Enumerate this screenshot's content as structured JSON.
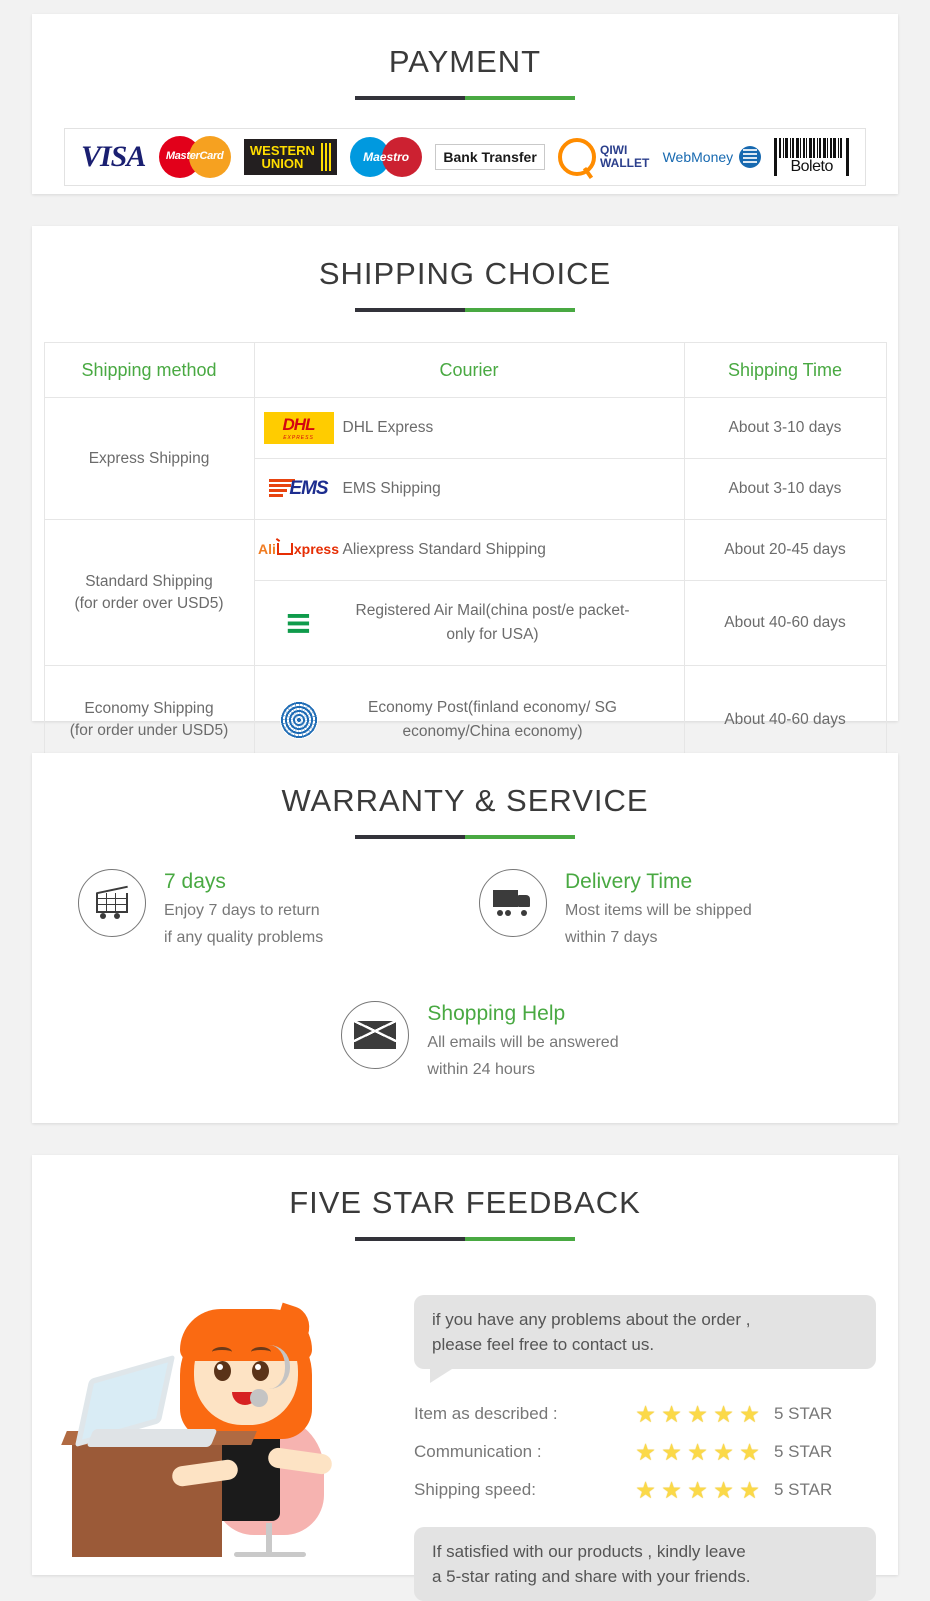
{
  "sections": {
    "payment": {
      "title": "PAYMENT",
      "methods": [
        {
          "name": "visa-logo",
          "label": "VISA"
        },
        {
          "name": "mastercard-logo",
          "label": "MasterCard"
        },
        {
          "name": "western-union-logo",
          "label_line1": "WESTERN",
          "label_line2": "UNION"
        },
        {
          "name": "maestro-logo",
          "label": "Maestro"
        },
        {
          "name": "bank-transfer-logo",
          "label": "Bank Transfer"
        },
        {
          "name": "qiwi-wallet-logo",
          "label_line1": "QIWI",
          "label_line2": "WALLET"
        },
        {
          "name": "webmoney-logo",
          "label": "WebMoney"
        },
        {
          "name": "boleto-logo",
          "label": "Boleto"
        }
      ]
    },
    "shipping": {
      "title": "SHIPPING CHOICE",
      "columns": [
        "Shipping method",
        "Courier",
        "Shipping Time"
      ],
      "groups": [
        {
          "method": "Express Shipping",
          "rows": [
            {
              "logo": "dhl-logo",
              "courier": "DHL Express",
              "time": "About 3-10 days"
            },
            {
              "logo": "ems-logo",
              "courier": "EMS Shipping",
              "time": "About 3-10 days"
            }
          ]
        },
        {
          "method": "Standard Shipping\n(for order over USD5)",
          "method_line1": "Standard Shipping",
          "method_line2": "(for order over USD5)",
          "rows": [
            {
              "logo": "aliexpress-logo",
              "courier": "Aliexpress Standard Shipping",
              "time": "About 20-45 days"
            },
            {
              "logo": "china-post-logo",
              "courier": "Registered Air Mail(china post/e packet-only for USA)",
              "time": "About 40-60 days"
            }
          ]
        },
        {
          "method_line1": "Economy Shipping",
          "method_line2": "(for order under USD5)",
          "rows": [
            {
              "logo": "un-post-logo",
              "courier": "Economy Post(finland economy/ SG economy/China economy)",
              "time": "About 40-60 days"
            }
          ]
        }
      ],
      "logo_text": {
        "dhl": "DHL",
        "dhl_sub": "EXPRESS",
        "ems": "EMS",
        "ali_a": "Ali",
        "ali_x": "xpress",
        "china_post": "≡"
      }
    },
    "warranty": {
      "title": "WARRANTY & SERVICE",
      "items": [
        {
          "icon": "cart-icon",
          "heading": "7 days",
          "line1": "Enjoy 7 days to return",
          "line2": "if any quality problems"
        },
        {
          "icon": "truck-icon",
          "heading": "Delivery Time",
          "line1": "Most items will be shipped",
          "line2": "within 7 days"
        },
        {
          "icon": "envelope-icon",
          "heading": "Shopping Help",
          "line1": "All emails will be answered",
          "line2": "within 24 hours"
        }
      ]
    },
    "feedback": {
      "title": "FIVE STAR FEEDBACK",
      "bubble_top_line1": "if you have any problems about the order ,",
      "bubble_top_line2": "please feel free to contact us.",
      "ratings": [
        {
          "label": "Item as described :",
          "stars": 5,
          "value": "5 STAR"
        },
        {
          "label": "Communication :",
          "stars": 5,
          "value": "5 STAR"
        },
        {
          "label": "Shipping speed:",
          "stars": 5,
          "value": "5 STAR"
        }
      ],
      "bubble_bottom_line1": "If satisfied with our products , kindly leave",
      "bubble_bottom_line2": "a 5-star rating and share with your friends.",
      "star_glyph": "★",
      "illustration": "customer-service-agent-illustration"
    }
  },
  "colors": {
    "green": "#49a942",
    "dark": "#33333a",
    "text_gray": "#6b6b6b",
    "page_bg": "#f2f2f2",
    "panel_bg": "#ffffff"
  }
}
